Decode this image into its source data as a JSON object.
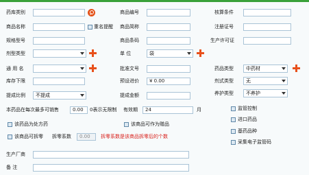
{
  "labels": {
    "drug_category": "药库类别",
    "product_code": "商品编号",
    "barcode": "核算条件",
    "product_name": "商品名称",
    "dup_prompt": "重名提醒",
    "product_abbr": "商品简称",
    "reg_number": "注册证号",
    "spec_model": "规格型号",
    "product_barcode": "商品条码",
    "production_license": "生产许可证",
    "dosage_form": "剂型类型",
    "unit": "单  位",
    "generic_name": "通 用 名",
    "approval_no": "批准文号",
    "drug_type": "药品类型",
    "stock_lower": "库存下限",
    "ref_price": "预设进价",
    "prescription_type": "剂式类型",
    "commission_ratio": "提成比例",
    "commission_amount": "提成金额",
    "maintenance_type": "养护类型",
    "max_sale_prefix": "本药品在每次最多可销售",
    "max_sale_suffix": "0表示无限制",
    "validity": "有效期",
    "month": "月",
    "supervise_code": "监管控制",
    "otc_prescription": "该药品为处方药",
    "as_gift": "该商品可作为赠品",
    "import_drug": "进口药品",
    "splittable": "该商品可拆零",
    "split_factor": "拆零系数",
    "split_note": "拆零系数是该商品拆零后的个数",
    "base_drug": "基药品种",
    "collect_ecode": "采集电子监管码",
    "manufacturer": "生产厂商",
    "remarks": "备    注"
  },
  "values": {
    "drug_category": "",
    "product_code": "",
    "barcode": "",
    "product_name": "",
    "product_abbr": "",
    "reg_number": "",
    "spec_model": "",
    "product_barcode": "",
    "production_license": "",
    "dosage_form": "",
    "unit": "袋",
    "generic_name": "",
    "approval_no": "",
    "drug_type": "中药材",
    "stock_lower": "",
    "ref_price": "¥ 0.00",
    "prescription_type": "无",
    "commission_ratio": "不提成",
    "commission_amount": "",
    "maintenance_type": "不养护",
    "max_sale": "0.00",
    "validity": "24",
    "split_factor": "0.00",
    "manufacturer": "",
    "remarks": ""
  },
  "checkboxes": {
    "dup_prompt": false,
    "otc_prescription": false,
    "as_gift": false,
    "splittable": false,
    "supervise_code": false,
    "import_drug": false,
    "base_drug": false,
    "collect_ecode": false
  },
  "colors": {
    "accent": "#e8501b",
    "border": "#a9c3d6",
    "note_red": "#d8201b",
    "topbar": "#3aa13a"
  }
}
